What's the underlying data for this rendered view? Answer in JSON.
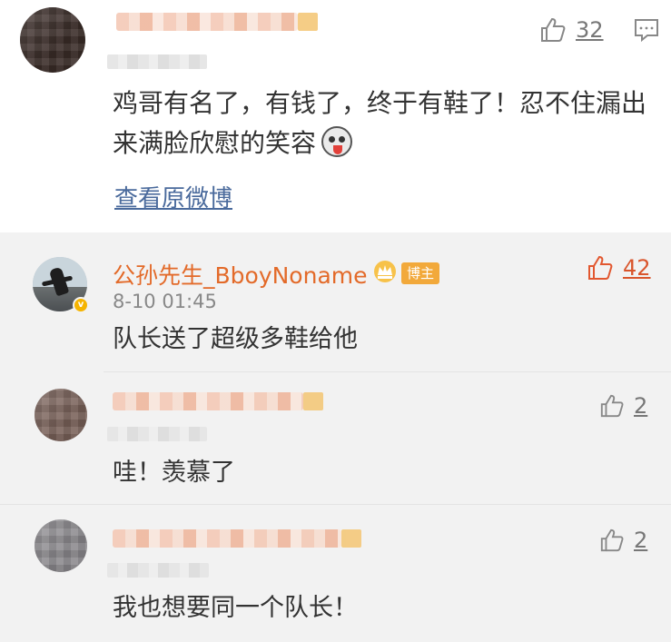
{
  "colors": {
    "page_background": "#f2f2f2",
    "card_background": "#ffffff",
    "blogger_name": "#e36a29",
    "link": "#4a6a9c",
    "blogger_badge": "#f2a93b",
    "liked": "#e2572f"
  },
  "top_comment": {
    "text": "鸡哥有名了，有钱了，终于有鞋了！忍不住漏出来满脸欣慰的笑容",
    "emoji": "doge-emoji",
    "like_count": "32",
    "like_icon": "thumbs-up-icon",
    "reply_icon": "comment-icon",
    "view_original": "查看原微博"
  },
  "replies": [
    {
      "name": "公孙先生_BboyNoname",
      "badges": [
        "crown-icon",
        "verified-icon"
      ],
      "badge_label": "博主",
      "time": "8-10 01:45",
      "text": "队长送了超级多鞋给他",
      "like_count": "42",
      "liked": true
    },
    {
      "text": "哇！羡慕了",
      "like_count": "2"
    },
    {
      "text": "我也想要同一个队长！",
      "like_count": "2"
    }
  ]
}
